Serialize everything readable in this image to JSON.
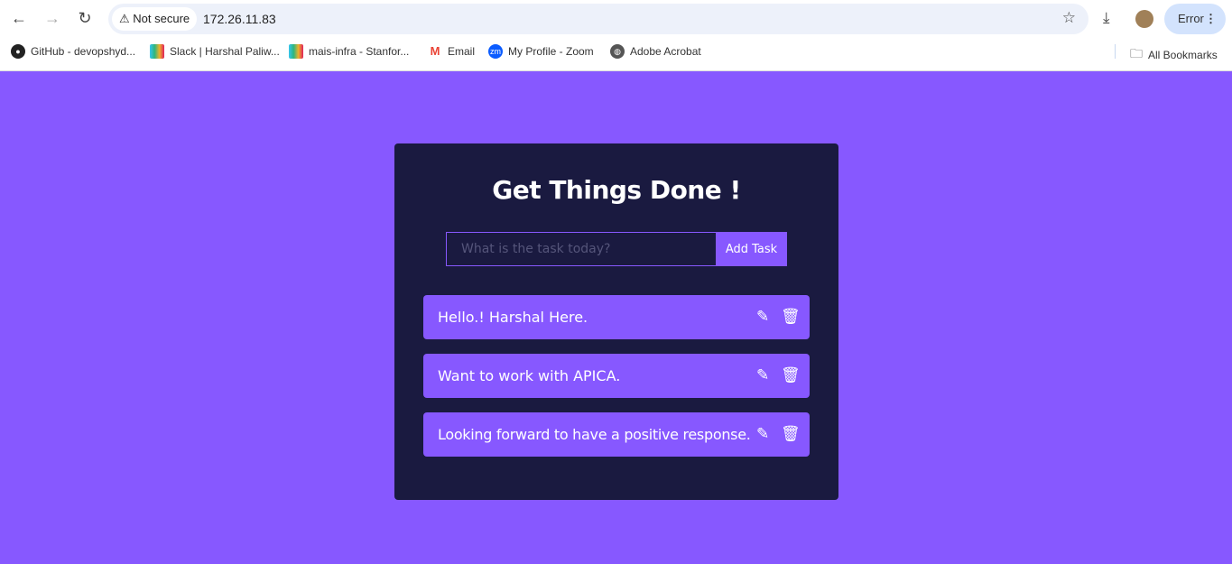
{
  "browser": {
    "not_secure": "Not secure",
    "url": "172.26.11.83",
    "profile_status": "Error",
    "bookmarks": [
      {
        "label": "GitHub - devopshyd...",
        "icon": "github-icon"
      },
      {
        "label": "Slack | Harshal Paliw...",
        "icon": "slack-icon"
      },
      {
        "label": "mais-infra - Stanfor...",
        "icon": "slack-icon"
      },
      {
        "label": "Email",
        "icon": "gmail-icon"
      },
      {
        "label": "My Profile - Zoom",
        "icon": "zoom-icon"
      },
      {
        "label": "Adobe Acrobat",
        "icon": "globe-icon"
      }
    ],
    "all_bookmarks": "All Bookmarks"
  },
  "app": {
    "title": "Get Things Done !",
    "input_placeholder": "What is the task today?",
    "add_label": "Add Task",
    "todos": [
      "Hello.! Harshal Here.",
      "Want to work with APICA.",
      "Looking forward to have a positive response."
    ]
  },
  "colors": {
    "background": "#8758ff",
    "card": "#1a1a40"
  }
}
